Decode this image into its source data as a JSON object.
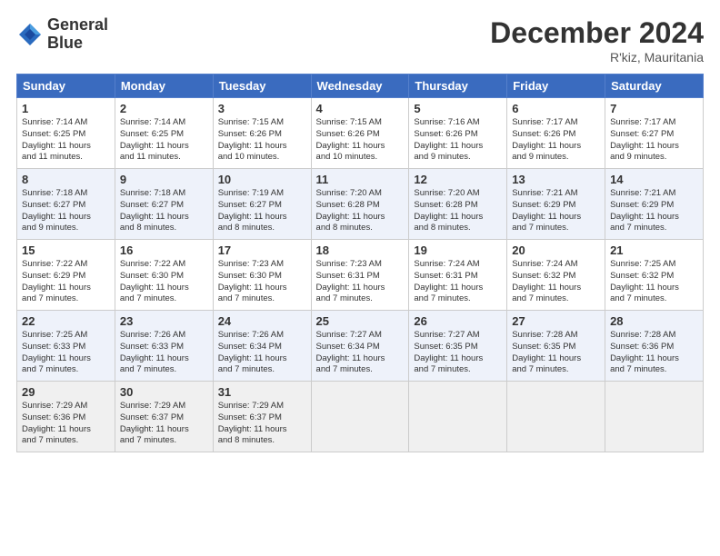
{
  "header": {
    "logo_line1": "General",
    "logo_line2": "Blue",
    "month_title": "December 2024",
    "location": "R'kiz, Mauritania"
  },
  "days_of_week": [
    "Sunday",
    "Monday",
    "Tuesday",
    "Wednesday",
    "Thursday",
    "Friday",
    "Saturday"
  ],
  "weeks": [
    [
      {
        "day": "1",
        "lines": [
          "Sunrise: 7:14 AM",
          "Sunset: 6:25 PM",
          "Daylight: 11 hours",
          "and 11 minutes."
        ]
      },
      {
        "day": "2",
        "lines": [
          "Sunrise: 7:14 AM",
          "Sunset: 6:25 PM",
          "Daylight: 11 hours",
          "and 11 minutes."
        ]
      },
      {
        "day": "3",
        "lines": [
          "Sunrise: 7:15 AM",
          "Sunset: 6:26 PM",
          "Daylight: 11 hours",
          "and 10 minutes."
        ]
      },
      {
        "day": "4",
        "lines": [
          "Sunrise: 7:15 AM",
          "Sunset: 6:26 PM",
          "Daylight: 11 hours",
          "and 10 minutes."
        ]
      },
      {
        "day": "5",
        "lines": [
          "Sunrise: 7:16 AM",
          "Sunset: 6:26 PM",
          "Daylight: 11 hours",
          "and 9 minutes."
        ]
      },
      {
        "day": "6",
        "lines": [
          "Sunrise: 7:17 AM",
          "Sunset: 6:26 PM",
          "Daylight: 11 hours",
          "and 9 minutes."
        ]
      },
      {
        "day": "7",
        "lines": [
          "Sunrise: 7:17 AM",
          "Sunset: 6:27 PM",
          "Daylight: 11 hours",
          "and 9 minutes."
        ]
      }
    ],
    [
      {
        "day": "8",
        "lines": [
          "Sunrise: 7:18 AM",
          "Sunset: 6:27 PM",
          "Daylight: 11 hours",
          "and 9 minutes."
        ]
      },
      {
        "day": "9",
        "lines": [
          "Sunrise: 7:18 AM",
          "Sunset: 6:27 PM",
          "Daylight: 11 hours",
          "and 8 minutes."
        ]
      },
      {
        "day": "10",
        "lines": [
          "Sunrise: 7:19 AM",
          "Sunset: 6:27 PM",
          "Daylight: 11 hours",
          "and 8 minutes."
        ]
      },
      {
        "day": "11",
        "lines": [
          "Sunrise: 7:20 AM",
          "Sunset: 6:28 PM",
          "Daylight: 11 hours",
          "and 8 minutes."
        ]
      },
      {
        "day": "12",
        "lines": [
          "Sunrise: 7:20 AM",
          "Sunset: 6:28 PM",
          "Daylight: 11 hours",
          "and 8 minutes."
        ]
      },
      {
        "day": "13",
        "lines": [
          "Sunrise: 7:21 AM",
          "Sunset: 6:29 PM",
          "Daylight: 11 hours",
          "and 7 minutes."
        ]
      },
      {
        "day": "14",
        "lines": [
          "Sunrise: 7:21 AM",
          "Sunset: 6:29 PM",
          "Daylight: 11 hours",
          "and 7 minutes."
        ]
      }
    ],
    [
      {
        "day": "15",
        "lines": [
          "Sunrise: 7:22 AM",
          "Sunset: 6:29 PM",
          "Daylight: 11 hours",
          "and 7 minutes."
        ]
      },
      {
        "day": "16",
        "lines": [
          "Sunrise: 7:22 AM",
          "Sunset: 6:30 PM",
          "Daylight: 11 hours",
          "and 7 minutes."
        ]
      },
      {
        "day": "17",
        "lines": [
          "Sunrise: 7:23 AM",
          "Sunset: 6:30 PM",
          "Daylight: 11 hours",
          "and 7 minutes."
        ]
      },
      {
        "day": "18",
        "lines": [
          "Sunrise: 7:23 AM",
          "Sunset: 6:31 PM",
          "Daylight: 11 hours",
          "and 7 minutes."
        ]
      },
      {
        "day": "19",
        "lines": [
          "Sunrise: 7:24 AM",
          "Sunset: 6:31 PM",
          "Daylight: 11 hours",
          "and 7 minutes."
        ]
      },
      {
        "day": "20",
        "lines": [
          "Sunrise: 7:24 AM",
          "Sunset: 6:32 PM",
          "Daylight: 11 hours",
          "and 7 minutes."
        ]
      },
      {
        "day": "21",
        "lines": [
          "Sunrise: 7:25 AM",
          "Sunset: 6:32 PM",
          "Daylight: 11 hours",
          "and 7 minutes."
        ]
      }
    ],
    [
      {
        "day": "22",
        "lines": [
          "Sunrise: 7:25 AM",
          "Sunset: 6:33 PM",
          "Daylight: 11 hours",
          "and 7 minutes."
        ]
      },
      {
        "day": "23",
        "lines": [
          "Sunrise: 7:26 AM",
          "Sunset: 6:33 PM",
          "Daylight: 11 hours",
          "and 7 minutes."
        ]
      },
      {
        "day": "24",
        "lines": [
          "Sunrise: 7:26 AM",
          "Sunset: 6:34 PM",
          "Daylight: 11 hours",
          "and 7 minutes."
        ]
      },
      {
        "day": "25",
        "lines": [
          "Sunrise: 7:27 AM",
          "Sunset: 6:34 PM",
          "Daylight: 11 hours",
          "and 7 minutes."
        ]
      },
      {
        "day": "26",
        "lines": [
          "Sunrise: 7:27 AM",
          "Sunset: 6:35 PM",
          "Daylight: 11 hours",
          "and 7 minutes."
        ]
      },
      {
        "day": "27",
        "lines": [
          "Sunrise: 7:28 AM",
          "Sunset: 6:35 PM",
          "Daylight: 11 hours",
          "and 7 minutes."
        ]
      },
      {
        "day": "28",
        "lines": [
          "Sunrise: 7:28 AM",
          "Sunset: 6:36 PM",
          "Daylight: 11 hours",
          "and 7 minutes."
        ]
      }
    ],
    [
      {
        "day": "29",
        "lines": [
          "Sunrise: 7:29 AM",
          "Sunset: 6:36 PM",
          "Daylight: 11 hours",
          "and 7 minutes."
        ]
      },
      {
        "day": "30",
        "lines": [
          "Sunrise: 7:29 AM",
          "Sunset: 6:37 PM",
          "Daylight: 11 hours",
          "and 7 minutes."
        ]
      },
      {
        "day": "31",
        "lines": [
          "Sunrise: 7:29 AM",
          "Sunset: 6:37 PM",
          "Daylight: 11 hours",
          "and 8 minutes."
        ]
      },
      null,
      null,
      null,
      null
    ]
  ]
}
